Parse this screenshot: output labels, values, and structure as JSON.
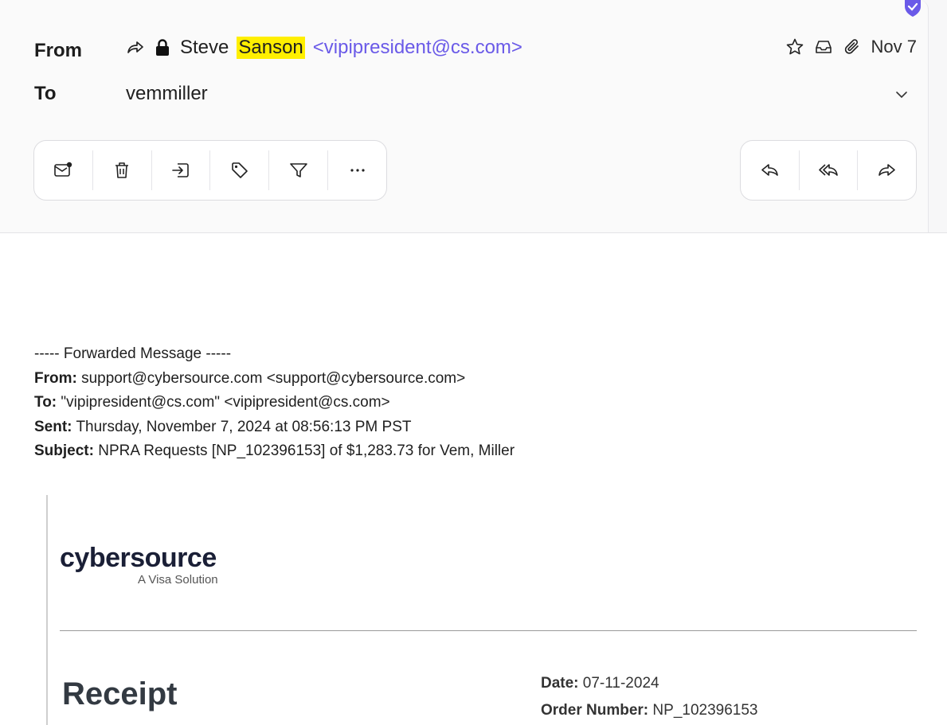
{
  "header": {
    "from_label": "From",
    "to_label": "To",
    "sender_first": "Steve",
    "sender_last": "Sanson",
    "sender_email": "<vipipresident@cs.com>",
    "to_value": "vemmiller",
    "date": "Nov 7"
  },
  "toolbar": {
    "left_actions": [
      "mark-unread",
      "delete",
      "move",
      "label",
      "filter",
      "more"
    ],
    "right_actions": [
      "reply",
      "reply-all",
      "forward"
    ]
  },
  "forwarded": {
    "divider_line": "----- Forwarded Message -----",
    "from_label": "From:",
    "from_value": "support@cybersource.com <support@cybersource.com>",
    "to_label": "To:",
    "to_value": "\"vipipresident@cs.com\" <vipipresident@cs.com>",
    "sent_label": "Sent:",
    "sent_value": "Thursday, November 7, 2024 at 08:56:13 PM PST",
    "subject_label": "Subject:",
    "subject_value": "NPRA Requests [NP_102396153] of $1,283.73 for Vem, Miller"
  },
  "receipt": {
    "brand": "cybersource",
    "brand_tagline": "A Visa Solution",
    "title": "Receipt",
    "date_label": "Date:",
    "date_value": "07-11-2024",
    "order_label": "Order Number:",
    "order_value": "NP_102396153"
  },
  "colors": {
    "accent": "#6a5ae8",
    "highlight": "#ffef00",
    "brand_text": "#1a1f36"
  }
}
